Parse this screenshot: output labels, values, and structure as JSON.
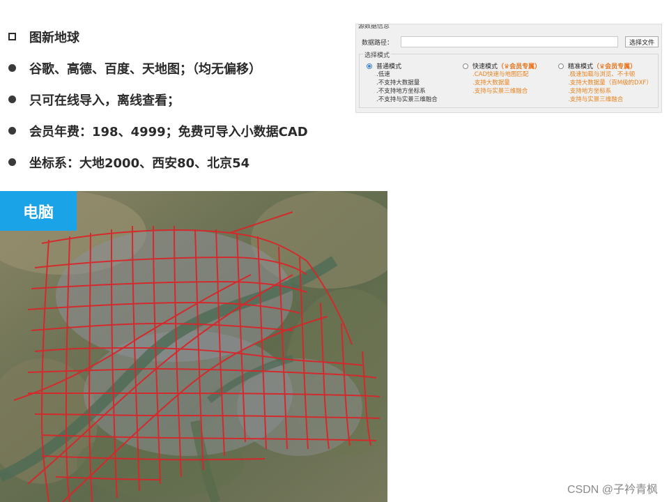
{
  "bullets": [
    {
      "marker": "square",
      "text": "图新地球"
    },
    {
      "marker": "dot",
      "text": "谷歌、高德、百度、天地图；（均无偏移）"
    },
    {
      "marker": "dot",
      "text": "只可在线导入，离线查看；"
    },
    {
      "marker": "dot",
      "text": "会员年费：198、4999；免费可导入小数据CAD"
    },
    {
      "marker": "dot",
      "text": "坐标系：大地2000、西安80、北京54"
    }
  ],
  "dialog": {
    "section_title": "源数据信息",
    "path_label": "数据路径：",
    "path_value": "",
    "choose_button": "选择文件",
    "mode_title": "选择模式",
    "modes": [
      {
        "name": "普通模式",
        "selected": true,
        "vip": "",
        "features": [
          ".低速",
          ".不支持大数据量",
          ".不支持地方坐标系",
          ".不支持与实景三维融合"
        ],
        "feature_color": "#333333"
      },
      {
        "name": "快速模式",
        "selected": false,
        "vip": "（♛会员专属）",
        "features": [
          ".CAD快速与地图匹配",
          ".支持大数据量",
          ".支持与实景三维融合"
        ],
        "feature_color": "#e8821e"
      },
      {
        "name": "精准模式",
        "selected": false,
        "vip": "（♛会员专属）",
        "features": [
          ".极速加载与浏览、不卡顿",
          ".支持大数据量（百M级的DXF）",
          ".支持地方坐标系",
          ".支持与实景三维融合"
        ],
        "feature_color": "#e8821e"
      }
    ]
  },
  "map": {
    "tag": "电脑",
    "tag_color": "#1aa3e6",
    "road_color": "#d8262a"
  },
  "watermark": "CSDN @子衿青枫"
}
